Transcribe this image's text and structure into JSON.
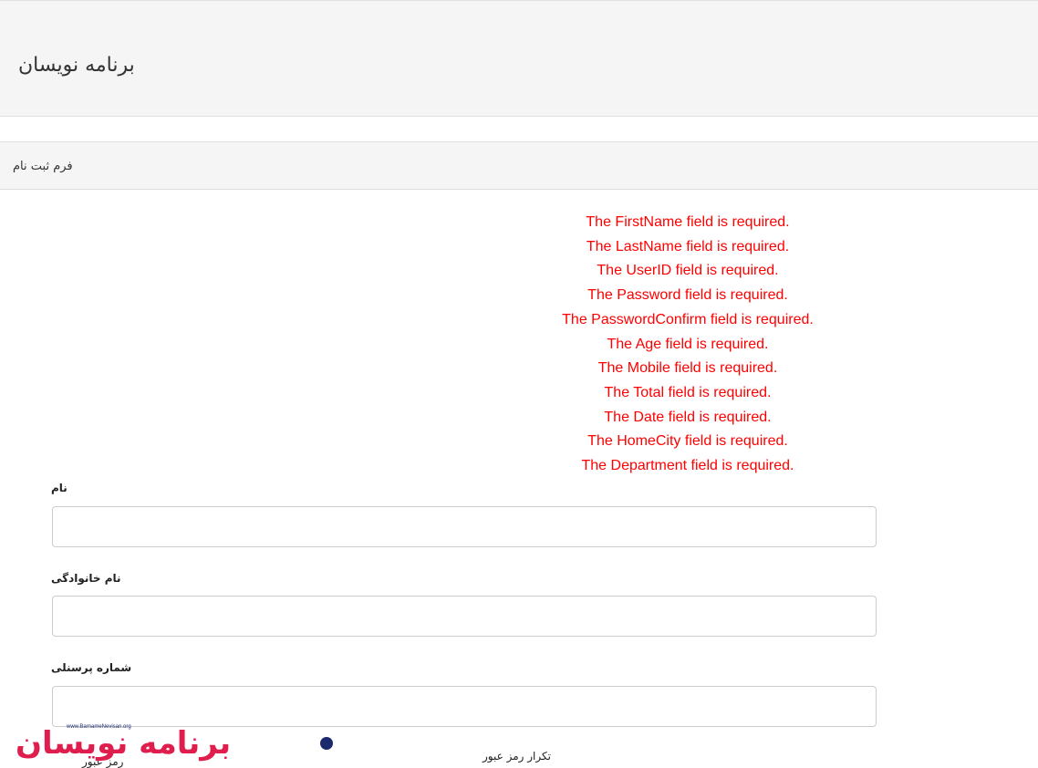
{
  "header": {
    "brand": "برنامه نویسان"
  },
  "panel": {
    "title": "فرم ثبت نام"
  },
  "validation_errors": [
    "The FirstName field is required.",
    "The LastName field is required.",
    "The UserID field is required.",
    "The Password field is required.",
    "The PasswordConfirm field is required.",
    "The Age field is required.",
    "The Mobile field is required.",
    "The Total field is required.",
    "The Date field is required.",
    "The HomeCity field is required.",
    "The Department field is required."
  ],
  "form": {
    "first_name": {
      "label": "نام",
      "value": ""
    },
    "last_name": {
      "label": "نام خانوادگی",
      "value": ""
    },
    "user_id": {
      "label": "شماره پرسنلی",
      "value": ""
    },
    "password_confirm": {
      "label": "تکرار رمز عبور"
    },
    "password": {
      "label": "رمز عبور"
    }
  },
  "watermark": {
    "url": "www.BarnameNevisan.org",
    "text": "برنامه نویسان"
  },
  "colors": {
    "error": "#ff0000",
    "navbar_bg": "#f5f5f5",
    "watermark_red": "#e01e4e",
    "watermark_blue": "#1a2a6c"
  }
}
